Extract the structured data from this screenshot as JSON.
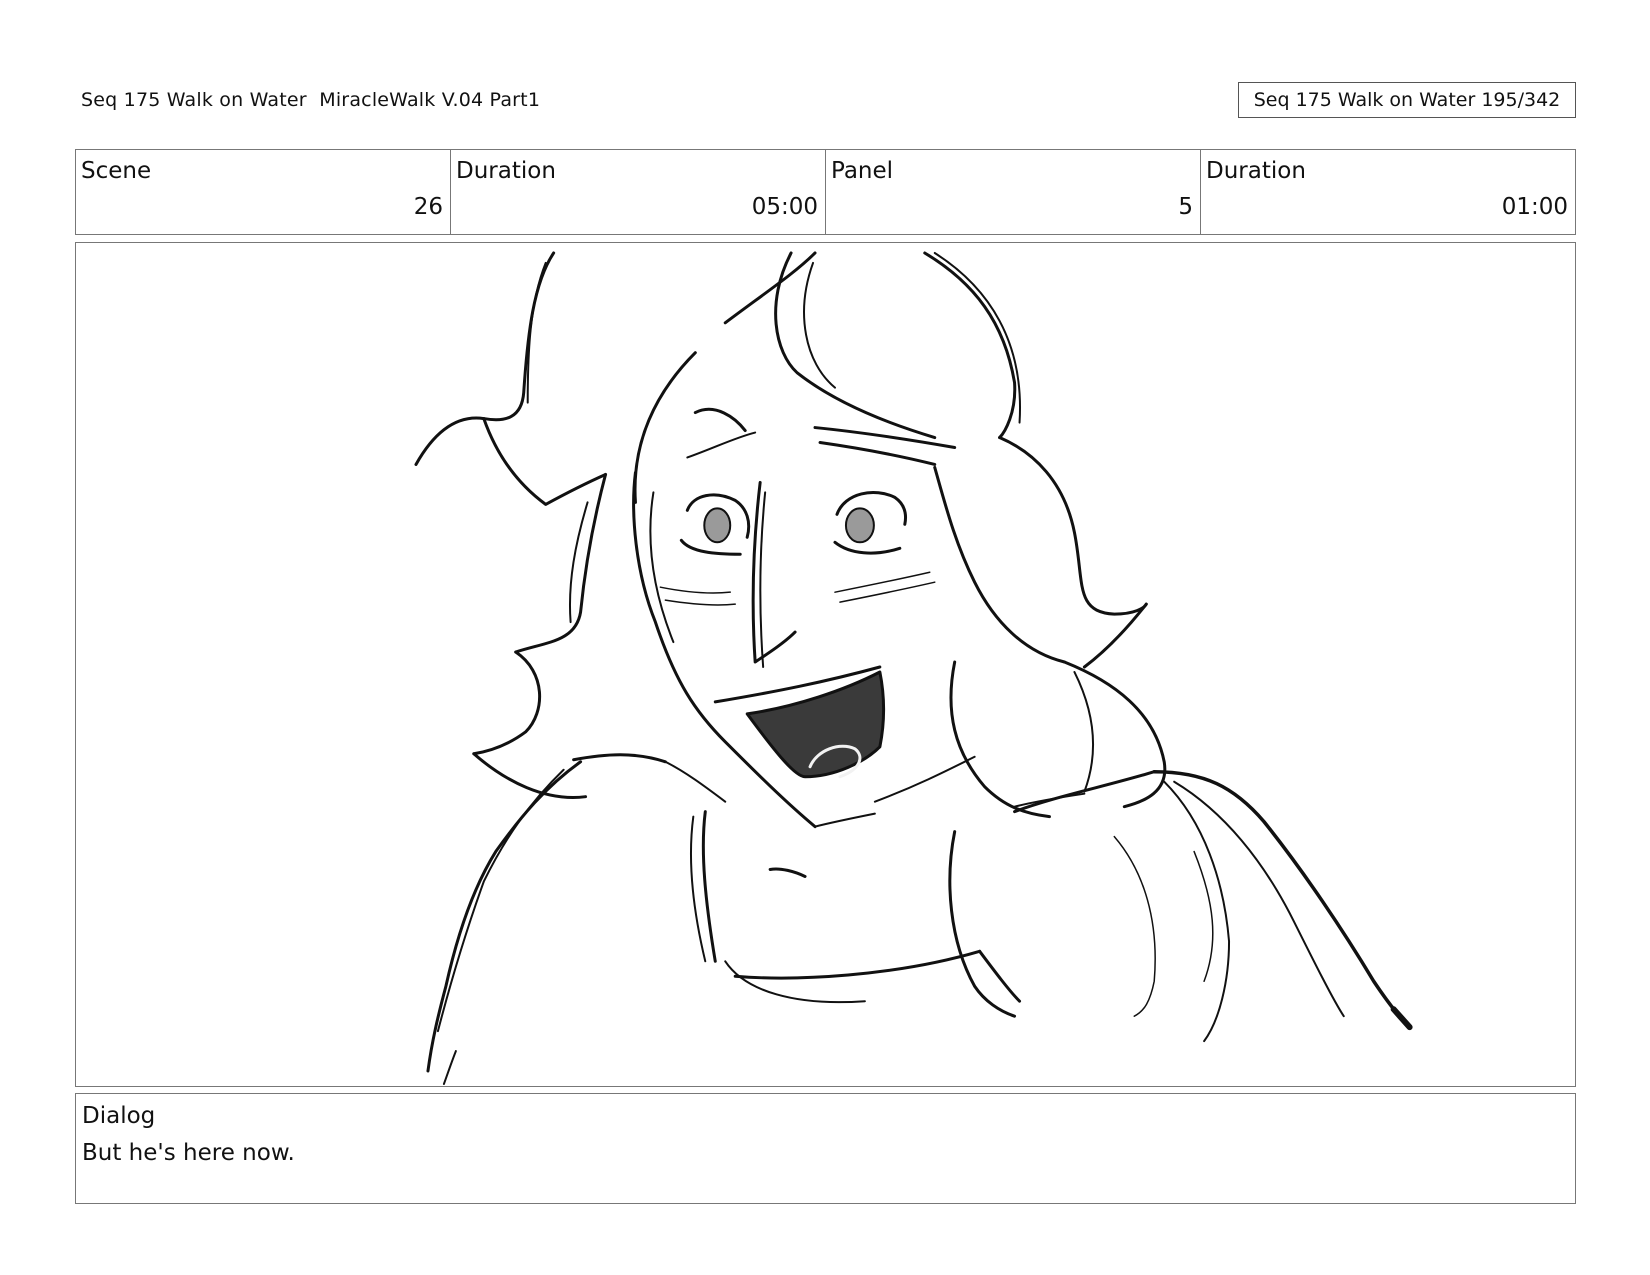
{
  "header": {
    "title": "Seq 175 Walk on Water  MiracleWalk V.04 Part1",
    "page_counter": "Seq 175 Walk on Water 195/342"
  },
  "info": {
    "scene_label": "Scene",
    "scene_value": "26",
    "scene_duration_label": "Duration",
    "scene_duration_value": "05:00",
    "panel_label": "Panel",
    "panel_value": "5",
    "panel_duration_label": "Duration",
    "panel_duration_value": "01:00"
  },
  "dialog": {
    "label": "Dialog",
    "text": "But he's here now."
  },
  "colors": {
    "line": "#111111",
    "eye": "#9a9a9a",
    "mouth": "#3a3a3a",
    "border": "#777777"
  }
}
